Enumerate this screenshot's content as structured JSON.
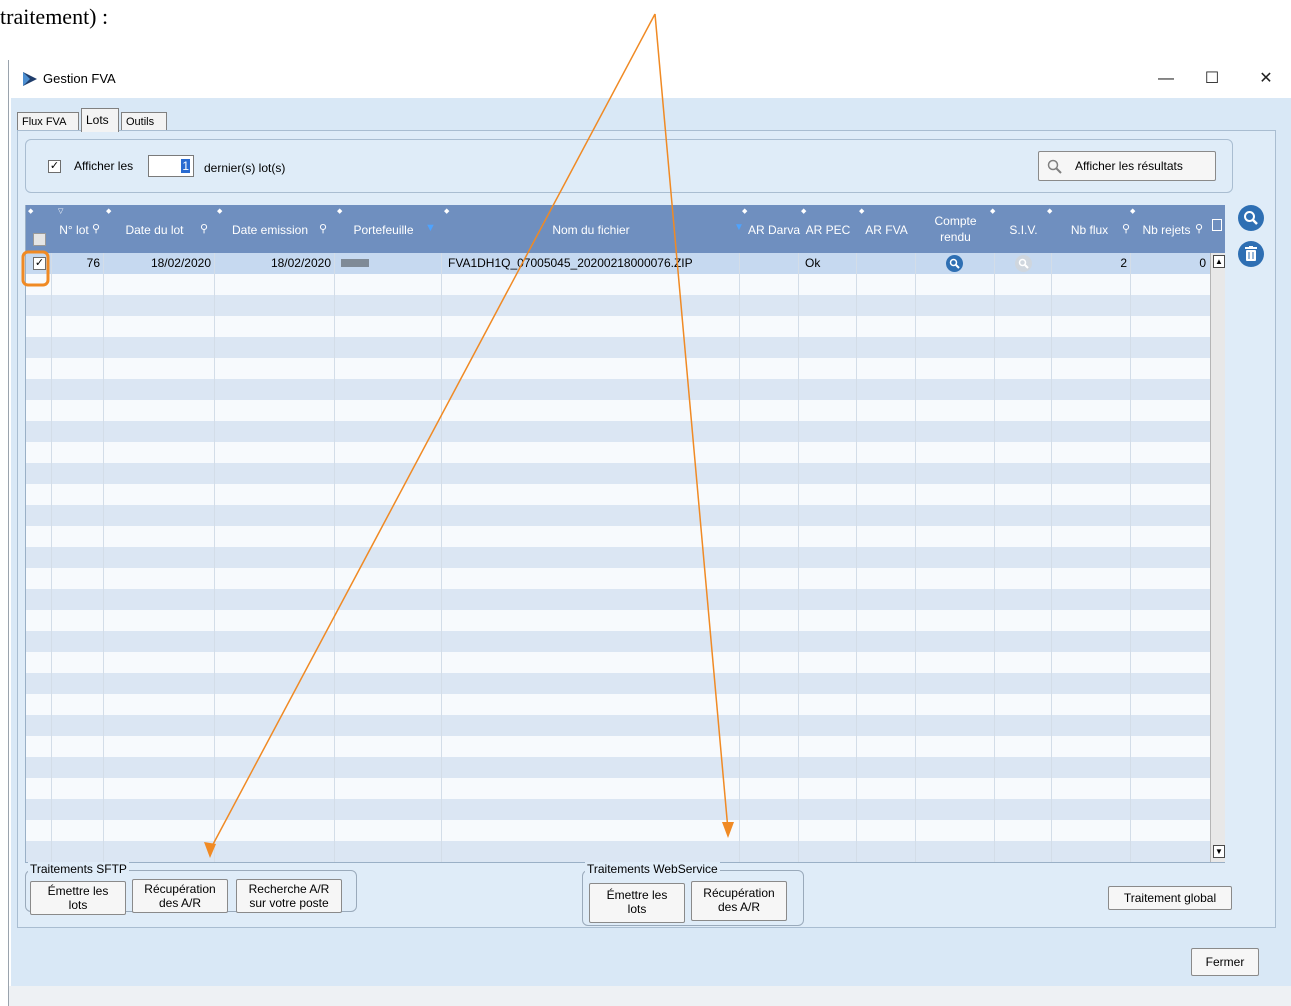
{
  "doc_caption": "traitement) :",
  "window": {
    "title": "Gestion FVA",
    "minimize": "—",
    "maximize": "☐",
    "close": "✕"
  },
  "tabs": [
    {
      "label": "Flux FVA",
      "active": false
    },
    {
      "label": "Lots",
      "active": true
    },
    {
      "label": "Outils",
      "active": false
    }
  ],
  "filter": {
    "checked": true,
    "label_before": "Afficher les",
    "count_value": "1",
    "label_after": "dernier(s) lot(s)",
    "show_results_button": "Afficher les résultats"
  },
  "table": {
    "columns": [
      {
        "key": "select",
        "label": ""
      },
      {
        "key": "lot",
        "label": "N° lot"
      },
      {
        "key": "date_lot",
        "label": "Date du lot"
      },
      {
        "key": "date_emission",
        "label": "Date emission"
      },
      {
        "key": "portefeuille",
        "label": "Portefeuille"
      },
      {
        "key": "nom_fichier",
        "label": "Nom du fichier"
      },
      {
        "key": "ar_darva",
        "label": "AR Darva"
      },
      {
        "key": "ar_pec",
        "label": "AR PEC"
      },
      {
        "key": "ar_fva",
        "label": "AR FVA"
      },
      {
        "key": "compte_rendu",
        "label": "Compte rendu"
      },
      {
        "key": "siv",
        "label": "S.I.V."
      },
      {
        "key": "nb_flux",
        "label": "Nb flux"
      },
      {
        "key": "nb_rejets",
        "label": "Nb rejets"
      }
    ],
    "rows": [
      {
        "checked": true,
        "lot": "76",
        "date_lot": "18/02/2020",
        "date_emission": "18/02/2020",
        "portefeuille": "",
        "nom_fichier": "FVA1DH1Q_07005045_20200218000076.ZIP",
        "ar_darva": "",
        "ar_pec": "Ok",
        "ar_fva": "",
        "nb_flux": "2",
        "nb_rejets": "0"
      }
    ]
  },
  "sftp": {
    "title": "Traitements SFTP",
    "buttons": [
      {
        "line1": "Émettre les",
        "line2": "lots"
      },
      {
        "line1": "Récupération",
        "line2": "des A/R"
      },
      {
        "line1": "Recherche A/R",
        "line2": "sur votre poste"
      }
    ]
  },
  "webservice": {
    "title": "Traitements WebService",
    "buttons": [
      {
        "line1": "Émettre les",
        "line2": "lots"
      },
      {
        "line1": "Récupération",
        "line2": "des A/R"
      }
    ]
  },
  "global_button": "Traitement global",
  "close_button": "Fermer",
  "colors": {
    "header": "#6f8fbf",
    "selected_row": "#c6d9f0",
    "stripe": "#dbe6f3",
    "annotation": "#f08a24"
  },
  "icons": [
    "search-icon",
    "delete-icon",
    "filter-icon",
    "zoom-icon",
    "sort-icon"
  ]
}
